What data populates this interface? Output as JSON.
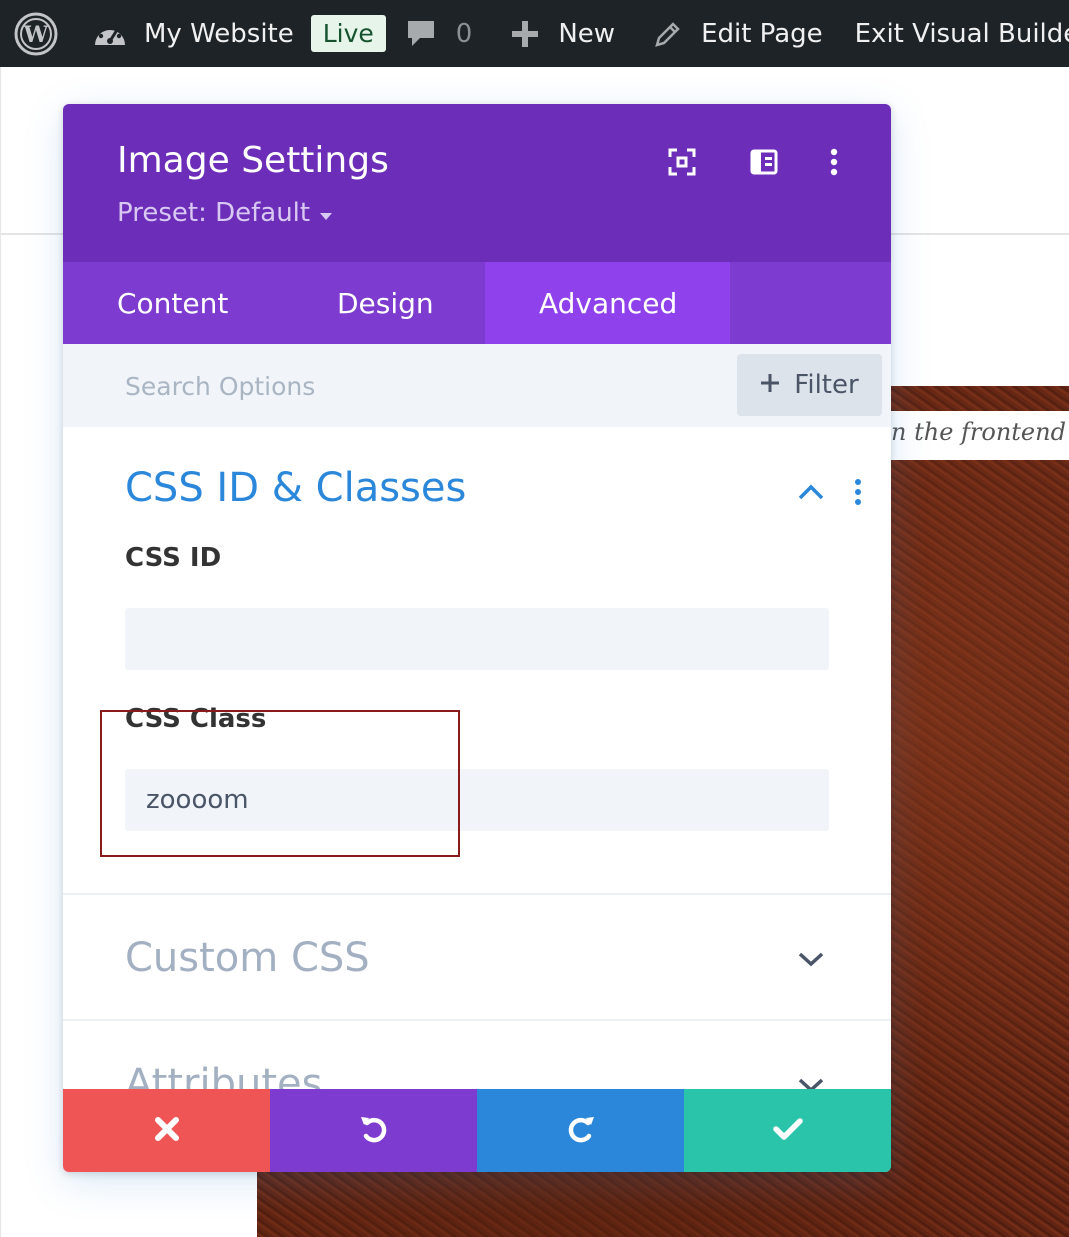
{
  "admin_bar": {
    "site_name": "My Website",
    "live_badge": "Live",
    "comments_count": "0",
    "new_label": "New",
    "edit_page_label": "Edit Page",
    "exit_builder_label": "Exit Visual Builder"
  },
  "page": {
    "caption_fragment": "n the frontend"
  },
  "modal": {
    "title": "Image Settings",
    "preset_label": "Preset: Default",
    "tabs": [
      {
        "label": "Content",
        "active": false
      },
      {
        "label": "Design",
        "active": false
      },
      {
        "label": "Advanced",
        "active": true
      }
    ],
    "search": {
      "placeholder": "Search Options",
      "value": ""
    },
    "filter_label": "Filter",
    "sections": {
      "css": {
        "title": "CSS ID & Classes",
        "expanded": true,
        "css_id_label": "CSS ID",
        "css_id_value": "",
        "css_class_label": "CSS Class",
        "css_class_value": "zoooom"
      },
      "custom_css": {
        "title": "Custom CSS",
        "expanded": false
      },
      "attributes": {
        "title": "Attributes",
        "expanded": false
      }
    },
    "footer": {
      "cancel_color": "#ef5555",
      "undo_color": "#7e3bd0",
      "redo_color": "#2b87da",
      "save_color": "#29c4a9"
    }
  },
  "colors": {
    "admin_bar_bg": "#1d2327",
    "header_purple": "#6c2eb9",
    "tabs_purple": "#7d3bcf",
    "active_tab": "#8f42ec",
    "accent_blue": "#2b87da"
  }
}
